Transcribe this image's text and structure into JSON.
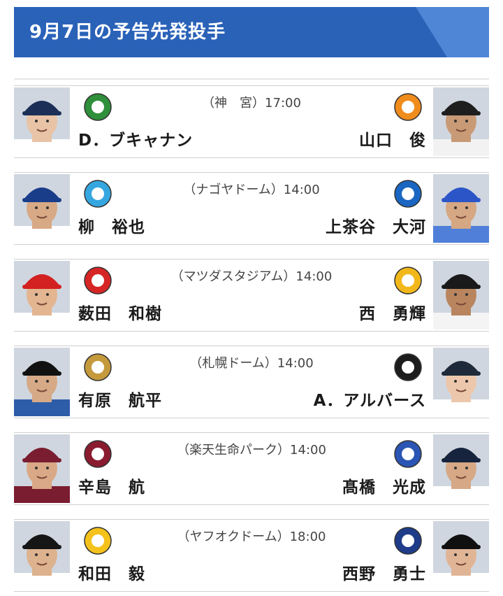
{
  "header": {
    "title": "9月7日の予告先発投手"
  },
  "games": [
    {
      "venue": "（神　宮）17:00",
      "home": {
        "pitcher": "D．ブキャナン",
        "logo_icon": "swallows-logo-icon",
        "cap": "#1c2f57",
        "skin": "#e8c3a6",
        "uniform": "#ffffff"
      },
      "away": {
        "pitcher": "山口　俊",
        "logo_icon": "giants-logo-icon",
        "cap": "#1e1e1e",
        "skin": "#c99a76",
        "uniform": "#f2f2f2"
      },
      "home_color": "#2f8f3a",
      "away_color": "#f08c1c"
    },
    {
      "venue": "（ナゴヤドーム）14:00",
      "home": {
        "pitcher": "柳　裕也",
        "logo_icon": "dragons-logo-icon",
        "cap": "#1a3d8a",
        "skin": "#d7a985",
        "uniform": "#ffffff"
      },
      "away": {
        "pitcher": "上茶谷　大河",
        "logo_icon": "baystars-logo-icon",
        "cap": "#2c56c8",
        "skin": "#d6a783",
        "uniform": "#4f7fd9"
      },
      "home_color": "#35a7e0",
      "away_color": "#1a66c2"
    },
    {
      "venue": "（マツダスタジアム）14:00",
      "home": {
        "pitcher": "薮田　和樹",
        "logo_icon": "carp-logo-icon",
        "cap": "#d32020",
        "skin": "#e3b590",
        "uniform": "#ffffff"
      },
      "away": {
        "pitcher": "西　勇輝",
        "logo_icon": "tigers-logo-icon",
        "cap": "#1a1a1a",
        "skin": "#b9855e",
        "uniform": "#f4f4f4"
      },
      "home_color": "#d62525",
      "away_color": "#f2b71a"
    },
    {
      "venue": "（札幌ドーム）14:00",
      "home": {
        "pitcher": "有原　航平",
        "logo_icon": "fighters-logo-icon",
        "cap": "#111111",
        "skin": "#d6a987",
        "uniform": "#2d5da8"
      },
      "away": {
        "pitcher": "A．アルバース",
        "logo_icon": "buffaloes-logo-icon",
        "cap": "#1e2a3a",
        "skin": "#edc7ac",
        "uniform": "#ffffff"
      },
      "home_color": "#c59a3c",
      "away_color": "#1c1c1c"
    },
    {
      "venue": "（楽天生命パーク）14:00",
      "home": {
        "pitcher": "辛島　航",
        "logo_icon": "eagles-logo-icon",
        "cap": "#7a1d30",
        "skin": "#d9a886",
        "uniform": "#7a1d30"
      },
      "away": {
        "pitcher": "髙橋　光成",
        "logo_icon": "lions-logo-icon",
        "cap": "#16243d",
        "skin": "#d6a886",
        "uniform": "#ffffff"
      },
      "home_color": "#8a1b2f",
      "away_color": "#2a55b4"
    },
    {
      "venue": "（ヤフオクドーム）18:00",
      "home": {
        "pitcher": "和田　毅",
        "logo_icon": "hawks-logo-icon",
        "cap": "#161616",
        "skin": "#ddb28e",
        "uniform": "#ffffff"
      },
      "away": {
        "pitcher": "西野　勇士",
        "logo_icon": "marines-logo-icon",
        "cap": "#101010",
        "skin": "#e0b596",
        "uniform": "#ffffff"
      },
      "home_color": "#f4c21b",
      "away_color": "#1f3c8a"
    }
  ]
}
